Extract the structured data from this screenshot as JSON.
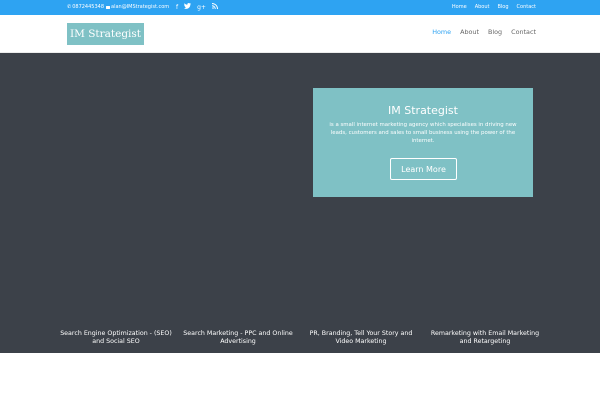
{
  "topbar": {
    "phone": "0872445348",
    "email": "alan@IMStrategist.com",
    "social": {
      "facebook": "f",
      "twitter": "twitter-icon",
      "googleplus": "g+",
      "rss": "rss-icon"
    },
    "nav": [
      "Home",
      "About",
      "Blog",
      "Contact"
    ]
  },
  "header": {
    "logo_text": "IM Strategist",
    "nav": [
      {
        "label": "Home",
        "active": true
      },
      {
        "label": "About",
        "active": false
      },
      {
        "label": "Blog",
        "active": false
      },
      {
        "label": "Contact",
        "active": false
      }
    ]
  },
  "hero": {
    "promo": {
      "title": "IM Strategist",
      "description": "is a small internet marketing agency which specialises in driving new leads, customers and sales to small business using the power of the internet.",
      "button": "Learn More"
    },
    "services": [
      "Search Engine Optimization - (SEO) and Social SEO",
      "Search Marketing - PPC and Online Advertising",
      "PR, Branding, Tell Your Story and Video Marketing",
      "Remarketing with Email Marketing and Retargeting"
    ]
  },
  "colors": {
    "topbar": "#2ea3f2",
    "hero": "#3c4149",
    "teal": "#7fc1c5",
    "active_nav": "#2ea3f2"
  }
}
